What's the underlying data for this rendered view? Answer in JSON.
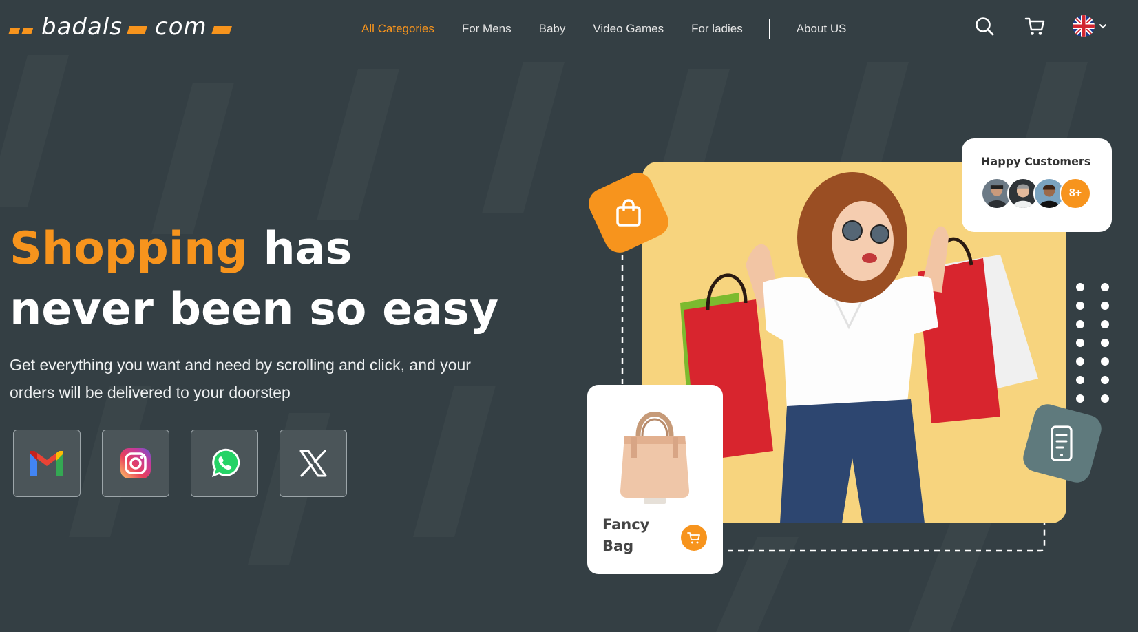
{
  "brand": {
    "left_word": "badals",
    "right_word": "com"
  },
  "nav": {
    "items": [
      {
        "label": "All Categories",
        "active": true
      },
      {
        "label": "For Mens",
        "active": false
      },
      {
        "label": "Baby",
        "active": false
      },
      {
        "label": "Video Games",
        "active": false
      },
      {
        "label": "For ladies",
        "active": false
      }
    ],
    "about": "About US",
    "icons": [
      "search-icon",
      "cart-icon",
      "uk-flag-icon",
      "chevron-down-icon"
    ]
  },
  "hero": {
    "title_highlight": "Shopping",
    "title_rest_line1": " has",
    "title_line2": "never been so easy",
    "subtitle": "Get everything you want and need by scrolling and click, and your orders will be delivered to your doorstep"
  },
  "socials": [
    "gmail-icon",
    "instagram-icon",
    "whatsapp-icon",
    "x-icon"
  ],
  "happy_customers": {
    "title": "Happy Customers",
    "more": "8+"
  },
  "product": {
    "name": "Fancy Bag"
  },
  "colors": {
    "accent": "#f7941d",
    "background": "#343f44",
    "photo_bg": "#f7d47e",
    "phone_badge": "#5f7a7d"
  }
}
